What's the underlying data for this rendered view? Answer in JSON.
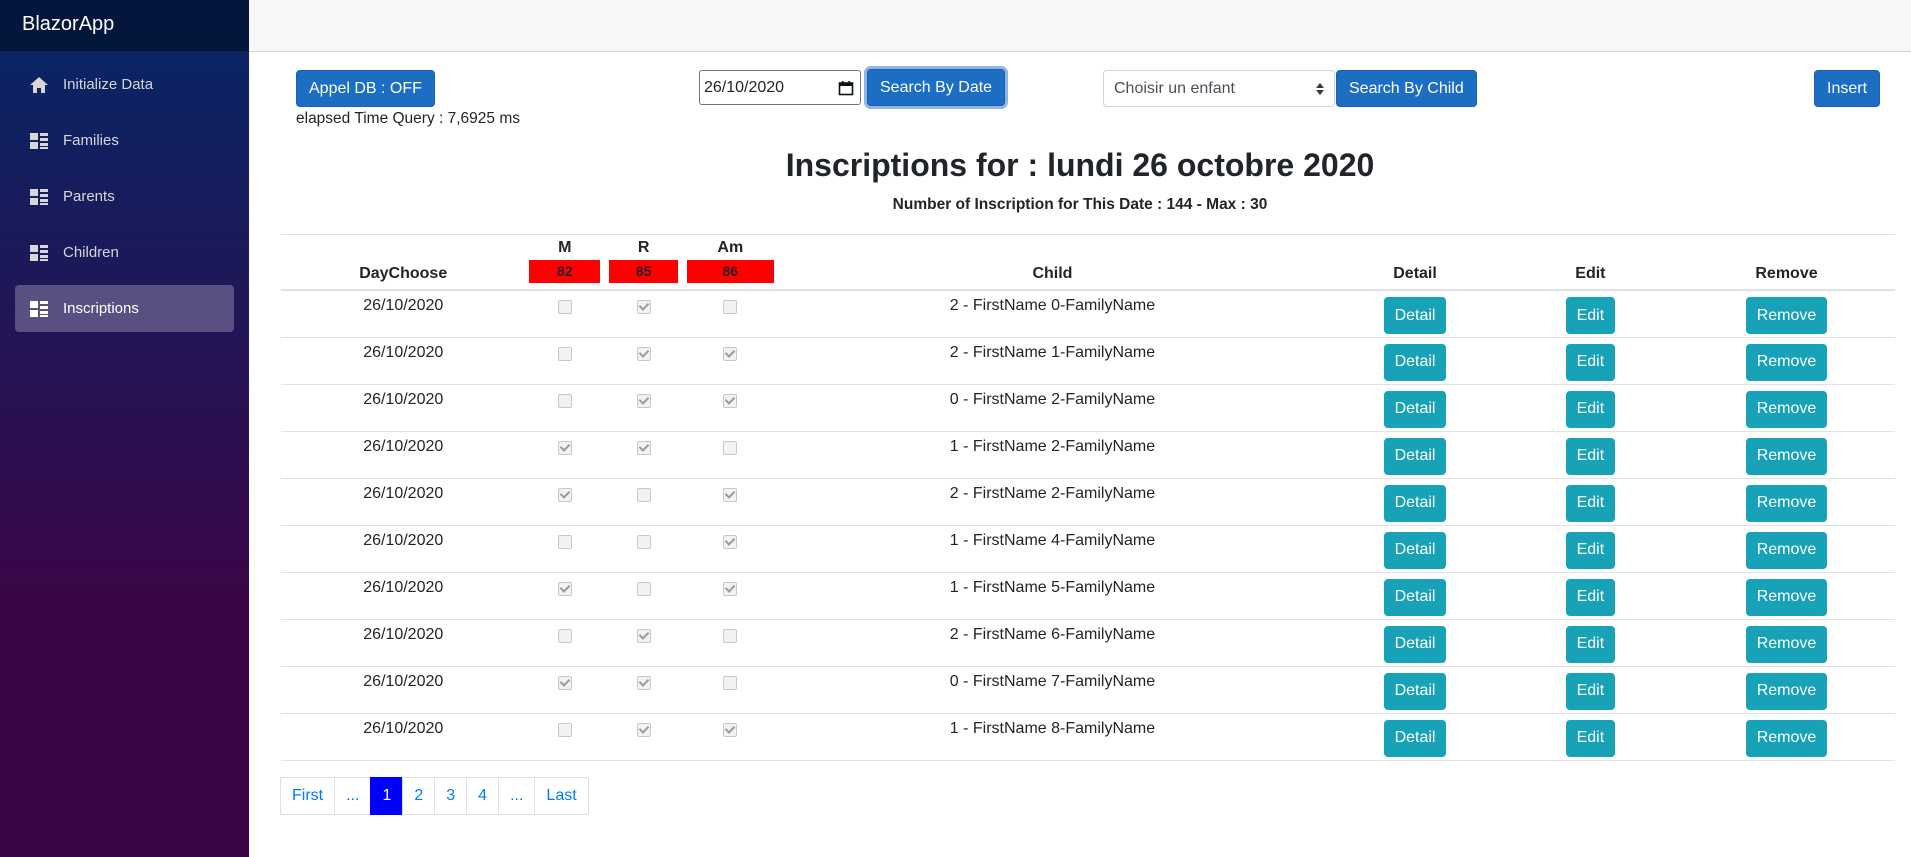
{
  "sidebar": {
    "brand": "BlazorApp",
    "items": [
      {
        "label": "Initialize Data",
        "icon": "home-icon"
      },
      {
        "label": "Families",
        "icon": "list-icon"
      },
      {
        "label": "Parents",
        "icon": "list-icon"
      },
      {
        "label": "Children",
        "icon": "list-icon"
      },
      {
        "label": "Inscriptions",
        "icon": "list-icon",
        "active": true
      }
    ]
  },
  "toolbar": {
    "appel_db_label": "Appel DB : OFF",
    "elapsed": "elapsed Time Query : 7,6925 ms",
    "date_value": "26/10/2020",
    "search_date_label": "Search By Date",
    "child_select_value": "Choisir un enfant",
    "search_child_label": "Search By Child",
    "insert_label": "Insert"
  },
  "heading": {
    "title": "Inscriptions for : lundi 26 octobre 2020",
    "subtitle": "Number of Inscription for This Date : 144 - Max : 30"
  },
  "table": {
    "headers": {
      "day": "DayChoose",
      "m": "M",
      "r": "R",
      "am": "Am",
      "child": "Child",
      "detail": "Detail",
      "edit": "Edit",
      "remove": "Remove"
    },
    "counts": {
      "m": "82",
      "r": "85",
      "am": "86"
    },
    "button_labels": {
      "detail": "Detail",
      "edit": "Edit",
      "remove": "Remove"
    },
    "rows": [
      {
        "day": "26/10/2020",
        "m": false,
        "r": true,
        "am": false,
        "child": "2 - FirstName 0-FamilyName"
      },
      {
        "day": "26/10/2020",
        "m": false,
        "r": true,
        "am": true,
        "child": "2 - FirstName 1-FamilyName"
      },
      {
        "day": "26/10/2020",
        "m": false,
        "r": true,
        "am": true,
        "child": "0 - FirstName 2-FamilyName"
      },
      {
        "day": "26/10/2020",
        "m": true,
        "r": true,
        "am": false,
        "child": "1 - FirstName 2-FamilyName"
      },
      {
        "day": "26/10/2020",
        "m": true,
        "r": false,
        "am": true,
        "child": "2 - FirstName 2-FamilyName"
      },
      {
        "day": "26/10/2020",
        "m": false,
        "r": false,
        "am": true,
        "child": "1 - FirstName 4-FamilyName"
      },
      {
        "day": "26/10/2020",
        "m": true,
        "r": false,
        "am": true,
        "child": "1 - FirstName 5-FamilyName"
      },
      {
        "day": "26/10/2020",
        "m": false,
        "r": true,
        "am": false,
        "child": "2 - FirstName 6-FamilyName"
      },
      {
        "day": "26/10/2020",
        "m": true,
        "r": true,
        "am": false,
        "child": "0 - FirstName 7-FamilyName"
      },
      {
        "day": "26/10/2020",
        "m": false,
        "r": true,
        "am": true,
        "child": "1 - FirstName 8-FamilyName"
      }
    ]
  },
  "pagination": {
    "items": [
      {
        "label": "First",
        "active": false
      },
      {
        "label": "...",
        "active": false
      },
      {
        "label": "1",
        "active": true
      },
      {
        "label": "2",
        "active": false
      },
      {
        "label": "3",
        "active": false
      },
      {
        "label": "4",
        "active": false
      },
      {
        "label": "...",
        "active": false
      },
      {
        "label": "Last",
        "active": false
      }
    ]
  }
}
